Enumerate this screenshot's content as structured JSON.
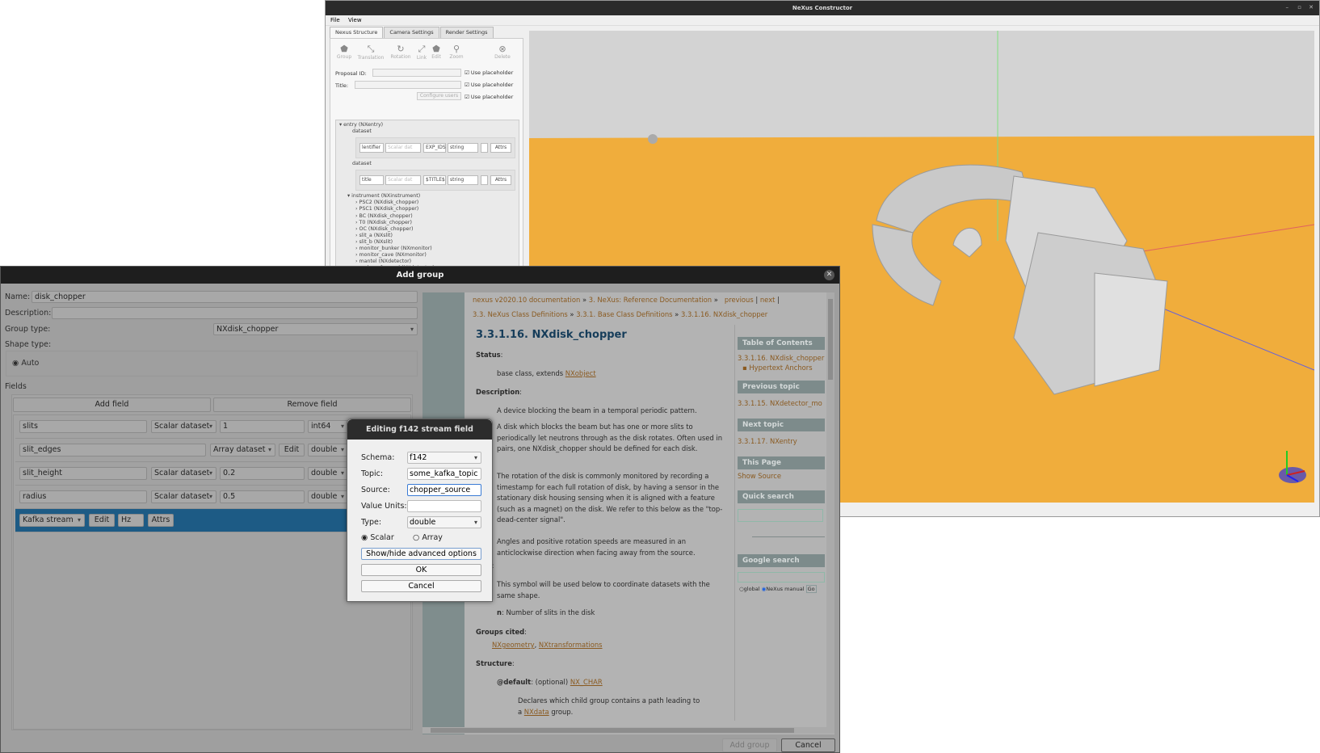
{
  "main_window": {
    "title": "NeXus Constructor",
    "menu": [
      "File",
      "View"
    ],
    "tabs": [
      "Nexus Structure",
      "Camera Settings",
      "Render Settings"
    ],
    "toolbar": [
      "Group",
      "Translation",
      "Rotation",
      "Link",
      "Edit",
      "Zoom",
      "Delete"
    ],
    "proposal_label": "Proposal ID:",
    "title_label": "Title:",
    "configure_users": "Configure users",
    "use_placeholder": "Use placeholder",
    "tree": {
      "entry": "entry (NXentry)",
      "dataset_label": "dataset",
      "datasets": [
        {
          "name": "lentifier",
          "type": "Scalar dat",
          "value": "EXP_IDS",
          "dtype": "string",
          "attrs": "Attrs"
        },
        {
          "name": "title",
          "type": "Scalar dat",
          "value": "$TITLE$",
          "dtype": "string",
          "attrs": "Attrs"
        }
      ],
      "instrument": "instrument (NXinstrument)",
      "children": [
        "PSC2 (NXdisk_chopper)",
        "PSC1 (NXdisk_chopper)",
        "BC (NXdisk_chopper)",
        "T0 (NXdisk_chopper)",
        "OC (NXdisk_chopper)",
        "slit_a (NXslit)",
        "slit_b (NXslit)",
        "monitor_bunker (NXmonitor)",
        "monitor_cave (NXmonitor)",
        "mantel (NXdetector)",
        "endcap_forward (NXdetector)"
      ]
    },
    "colors": {
      "ground": "#f0ad3c",
      "sky": "#d3d3d3"
    }
  },
  "add_group": {
    "title": "Add group",
    "name_label": "Name:",
    "name_value": "disk_chopper",
    "description_label": "Description:",
    "description_value": "",
    "group_type_label": "Group type:",
    "group_type_value": "NXdisk_chopper",
    "shape_type_label": "Shape type:",
    "shape_auto": "Auto",
    "fields_label": "Fields",
    "add_field": "Add field",
    "remove_field": "Remove field",
    "fields": [
      {
        "name": "slits",
        "kind": "Scalar dataset",
        "value": "1",
        "dtype": "int64"
      },
      {
        "name": "slit_edges",
        "kind": "Array dataset",
        "edit": "Edit",
        "dtype": "double"
      },
      {
        "name": "slit_height",
        "kind": "Scalar dataset",
        "value": "0.2",
        "dtype": "double"
      },
      {
        "name": "radius",
        "kind": "Scalar dataset",
        "value": "0.5",
        "dtype": "double"
      }
    ],
    "stream_row": {
      "kind": "Kafka stream",
      "edit": "Edit",
      "units": "Hz",
      "attrs": "Attrs"
    },
    "add_group_button": "Add group",
    "cancel_button": "Cancel"
  },
  "docs": {
    "breadcrumb1": [
      "nexus v2020.10 documentation",
      "3. NeXus: Reference Documentation"
    ],
    "nav": [
      "previous",
      "next"
    ],
    "breadcrumb2": [
      "3.3. NeXus Class Definitions",
      "3.3.1. Base Class Definitions",
      "3.3.1.16. NXdisk_chopper"
    ],
    "heading": "3.3.1.16. NXdisk_chopper",
    "status_label": "Status",
    "status_text": "base class, extends ",
    "status_link": "NXobject",
    "description_label": "Description",
    "desc1": "A device blocking the beam in a temporal periodic pattern.",
    "desc2": "A disk which blocks the beam but has one or more slits to periodically let neutrons through as the disk rotates. Often used in pairs, one NXdisk_chopper should be defined for each disk.",
    "desc3": "The rotation of the disk is commonly monitored by recording a timestamp for each full rotation of disk, by having a sensor in the stationary disk housing sensing when it is aligned with a feature (such as a magnet) on the disk. We refer to this below as the \"top-dead-center signal\".",
    "desc4": "Angles and positive rotation speeds are measured in an anticlockwise direction when facing away from the source.",
    "symbols_label": "bols",
    "symbols_text": "This symbol will be used below to coordinate datasets with the same shape.",
    "symbol_n": "n",
    "symbol_n_text": ": Number of slits in the disk",
    "groups_cited_label": "Groups cited",
    "groups_cited": [
      "NXgeometry",
      "NXtransformations"
    ],
    "structure_label": "Structure",
    "default_attr": "@default",
    "default_opt": ": (optional) ",
    "default_link": "NX_CHAR",
    "default_desc1": "Declares which child group contains a path leading to",
    "default_desc2a": "a ",
    "default_desc_link": "NXdata",
    "default_desc2b": " group.",
    "sidebar": {
      "toc": "Table of Contents",
      "toc_item": "3.3.1.16. NXdisk_chopper",
      "toc_sub": "Hypertext Anchors",
      "prev": "Previous topic",
      "prev_item": "3.3.1.15. NXdetector_mo",
      "next": "Next topic",
      "next_item": "3.3.1.17. NXentry",
      "this_page": "This Page",
      "show_source": "Show Source",
      "quick_search": "Quick search",
      "google_search": "Google search",
      "radio_global": "global",
      "radio_manual": "NeXus manual",
      "go": "Go"
    }
  },
  "stream_dialog": {
    "title": "Editing f142 stream field",
    "schema_label": "Schema:",
    "schema_value": "f142",
    "topic_label": "Topic:",
    "topic_value": "some_kafka_topic",
    "source_label": "Source:",
    "source_value": "chopper_source",
    "units_label": "Value Units:",
    "units_value": "",
    "type_label": "Type:",
    "type_value": "double",
    "scalar": "Scalar",
    "array": "Array",
    "selected_mode": "Scalar",
    "advanced": "Show/hide advanced options",
    "ok": "OK",
    "cancel": "Cancel"
  }
}
